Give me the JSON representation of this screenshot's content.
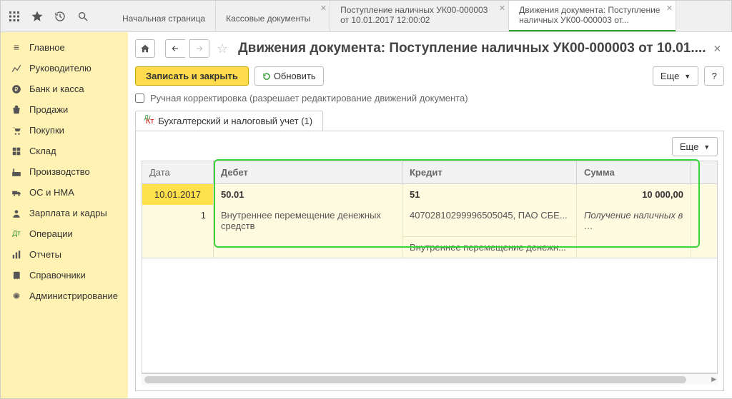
{
  "topTabs": [
    {
      "label": "Начальная страница",
      "closable": false
    },
    {
      "label": "Кассовые документы",
      "closable": true
    },
    {
      "label": "Поступление наличных УК00-000003 от 10.01.2017 12:00:02",
      "closable": true
    },
    {
      "label": "Движения документа: Поступление наличных УК00-000003 от...",
      "closable": true,
      "active": true
    }
  ],
  "sidebar": {
    "items": [
      {
        "label": "Главное"
      },
      {
        "label": "Руководителю"
      },
      {
        "label": "Банк и касса"
      },
      {
        "label": "Продажи"
      },
      {
        "label": "Покупки"
      },
      {
        "label": "Склад"
      },
      {
        "label": "Производство"
      },
      {
        "label": "ОС и НМА"
      },
      {
        "label": "Зарплата и кадры"
      },
      {
        "label": "Операции"
      },
      {
        "label": "Отчеты"
      },
      {
        "label": "Справочники"
      },
      {
        "label": "Администрирование"
      }
    ]
  },
  "header": {
    "title": "Движения документа: Поступление наличных УК00-000003 от 10.01...."
  },
  "toolbar": {
    "saveClose": "Записать и закрыть",
    "refresh": "Обновить",
    "more": "Еще",
    "help": "?"
  },
  "manualCheck": "Ручная корректировка (разрешает редактирование движений документа)",
  "pageTab": "Бухгалтерский и налоговый учет (1)",
  "innerMore": "Еще",
  "grid": {
    "headers": {
      "date": "Дата",
      "debit": "Дебет",
      "credit": "Кредит",
      "sum": "Сумма"
    },
    "row1": {
      "date": "10.01.2017",
      "debit": "50.01",
      "credit": "51",
      "sum": "10 000,00"
    },
    "row2": {
      "num": "1",
      "debitDesc": "Внутреннее перемещение денежных средств",
      "creditDesc": "40702810299996505045, ПАО СБЕ...",
      "sumDesc": "Получение наличных в …"
    },
    "row3": {
      "creditDesc2": "Внутреннее перемещение денежн..."
    }
  }
}
